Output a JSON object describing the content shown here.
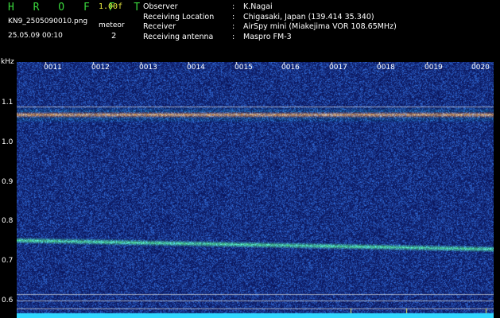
{
  "header": {
    "app_name": "H R O F F T",
    "version": "1.00f",
    "file_name": "KN9_2505090010.png",
    "datetime": "25.05.09 00:10",
    "meteor_label": "meteor",
    "meteor_count": "2"
  },
  "info": {
    "observer_label": "Observer",
    "observer_value": "K.Nagai",
    "location_label": "Receiving Location",
    "location_value": "Chigasaki, Japan (139.414 35.340)",
    "receiver_label": "Receiver",
    "receiver_value": "AirSpy mini (Miakejima VOR 108.65MHz)",
    "antenna_label": "Receiving antenna",
    "antenna_value": "Maspro FM-3",
    "separator": ":"
  },
  "axis": {
    "unit": "kHz",
    "y_ticks": [
      "1.1",
      "1.0",
      "0.9",
      "0.8",
      "0.7",
      "0.6"
    ],
    "time_ticks": [
      "0011",
      "0012",
      "0013",
      "0014",
      "0015",
      "0016",
      "0017",
      "0018",
      "0019",
      "0020"
    ]
  },
  "colors": {
    "background": "#000000",
    "noise": "#1a2a9a",
    "carrier": "#e04040",
    "trail": "#40e0a0",
    "baseline": "#30d8ff",
    "logo": "#39d63c",
    "version": "#e8e840"
  }
}
